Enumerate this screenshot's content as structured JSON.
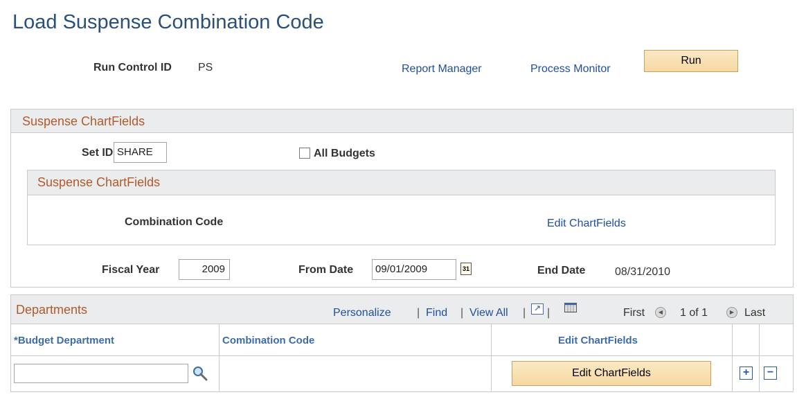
{
  "page": {
    "title": "Load Suspense Combination Code"
  },
  "run_control": {
    "label": "Run Control ID",
    "value": "PS",
    "report_manager": "Report Manager",
    "process_monitor": "Process Monitor",
    "run_label": "Run"
  },
  "suspense_section": {
    "header": "Suspense ChartFields",
    "setid_label": "Set ID",
    "setid_value": "SHARE",
    "all_budgets_label": "All Budgets",
    "all_budgets_checked": false,
    "inner": {
      "header": "Suspense ChartFields",
      "combination_code_label": "Combination Code",
      "edit_chartfields_link": "Edit ChartFields"
    },
    "fiscal_year_label": "Fiscal Year",
    "fiscal_year_value": "2009",
    "from_date_label": "From Date",
    "from_date_value": "09/01/2009",
    "calendar_icon_text": "31",
    "end_date_label": "End Date",
    "end_date_value": "08/31/2010"
  },
  "departments": {
    "header": "Departments",
    "toolbar": {
      "personalize": "Personalize",
      "find": "Find",
      "view_all": "View All",
      "sep": "|",
      "first": "First",
      "count": "1 of 1",
      "last": "Last"
    },
    "columns": [
      "*Budget Department",
      "Combination Code",
      "Edit ChartFields"
    ],
    "rows": [
      {
        "budget_department": "",
        "combination_code": "",
        "edit_button": "Edit ChartFields"
      }
    ],
    "add_row": "+",
    "delete_row": "−"
  }
}
